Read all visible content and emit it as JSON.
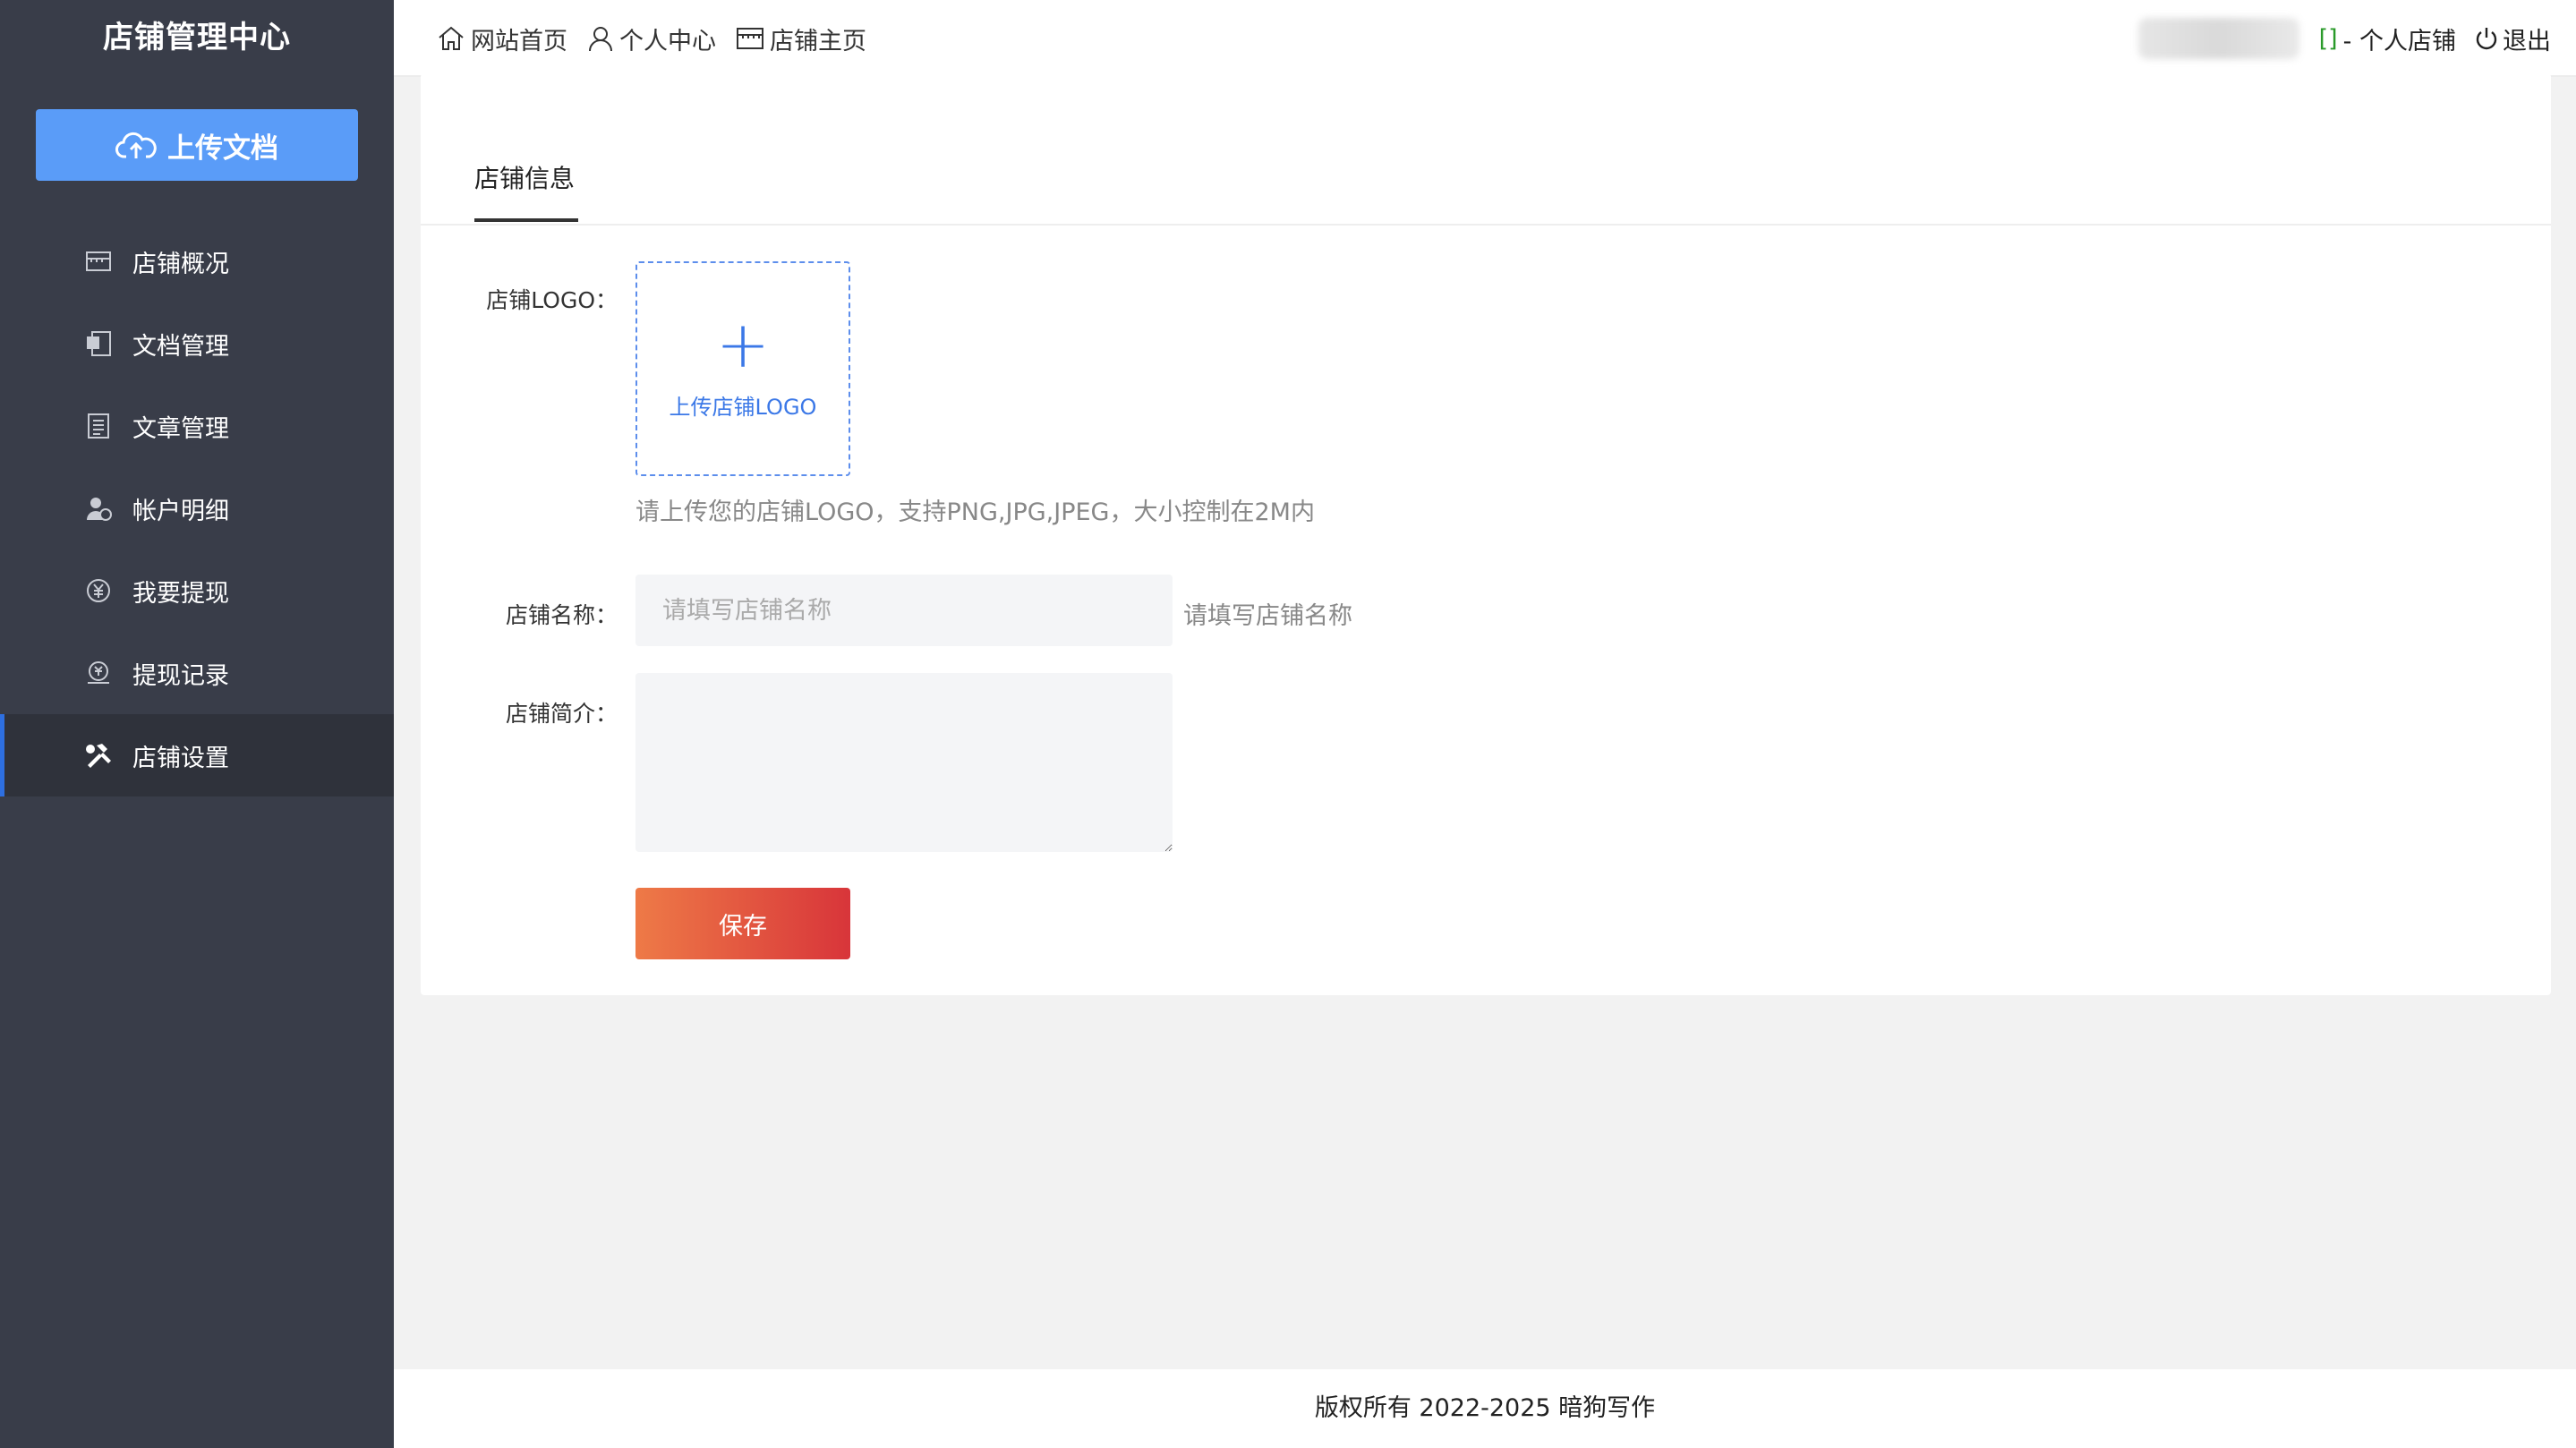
{
  "sidebar": {
    "title": "店铺管理中心",
    "upload_label": "上传文档",
    "items": [
      {
        "label": "店铺概况",
        "icon": "store-icon"
      },
      {
        "label": "文档管理",
        "icon": "word-doc-icon"
      },
      {
        "label": "文章管理",
        "icon": "article-icon"
      },
      {
        "label": "帐户明细",
        "icon": "account-icon"
      },
      {
        "label": "我要提现",
        "icon": "yen-icon"
      },
      {
        "label": "提现记录",
        "icon": "withdraw-record-icon"
      },
      {
        "label": "店铺设置",
        "icon": "tools-icon",
        "active": true
      }
    ]
  },
  "header": {
    "nav": [
      {
        "label": "网站首页",
        "icon": "home-icon"
      },
      {
        "label": "个人中心",
        "icon": "user-icon"
      },
      {
        "label": "店铺主页",
        "icon": "store-icon"
      }
    ],
    "shop_bracket": "[]",
    "shop_link": "- 个人店铺",
    "logout": "退出"
  },
  "main": {
    "tab": "店铺信息",
    "logo_label": "店铺LOGO：",
    "logo_upload_label": "上传店铺LOGO",
    "logo_hint": "请上传您的店铺LOGO，支持PNG,JPG,JPEG，大小控制在2M内",
    "name_label": "店铺名称：",
    "name_placeholder": "请填写店铺名称",
    "name_hint": "请填写店铺名称",
    "intro_label": "店铺简介：",
    "save_label": "保存"
  },
  "footer": {
    "copyright": "版权所有 2022-2025 暗狗写作"
  },
  "colors": {
    "sidebar_bg": "#393d49",
    "upload_btn": "#5a9cf8",
    "active_accent": "#2e6fe0",
    "save_gradient_start": "#ee7a47",
    "save_gradient_end": "#d8353a",
    "shop_bracket": "#2a9a2a"
  }
}
